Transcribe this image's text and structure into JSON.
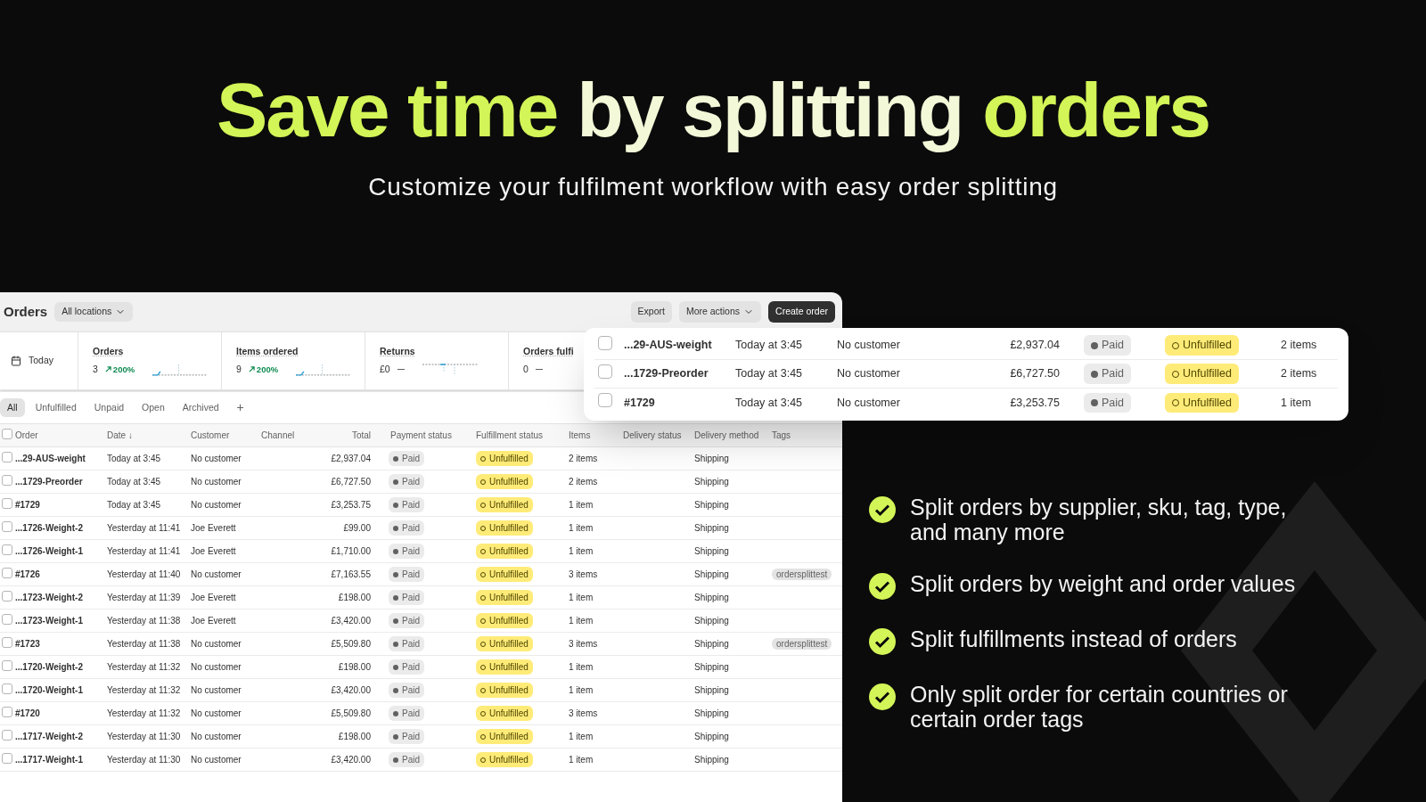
{
  "headline": [
    {
      "text": "Save time",
      "kind": "accent"
    },
    {
      "text": "by splitting",
      "kind": "plain"
    },
    {
      "text": "orders",
      "kind": "accent"
    }
  ],
  "subtitle": "Customize your fulfilment workflow with easy order splitting",
  "orders_page": {
    "title": "Orders",
    "location_filter": "All locations",
    "actions": [
      {
        "label": "Export",
        "kind": "secondary"
      },
      {
        "label": "More actions",
        "kind": "menu"
      },
      {
        "label": "Create order",
        "kind": "primary"
      }
    ],
    "date_range": "Today",
    "stats": [
      {
        "label": "Orders",
        "value": "3",
        "change": "200%",
        "kind": "increase"
      },
      {
        "label": "Items ordered",
        "value": "9",
        "change": "200%",
        "kind": "increase"
      },
      {
        "label": "Returns",
        "value": "£0",
        "kind": "flat"
      },
      {
        "label": "Orders fulfi",
        "value": "0",
        "kind": "flat"
      }
    ],
    "tabs": [
      {
        "label": "All",
        "selected": true
      },
      {
        "label": "Unfulfilled",
        "selected": false
      },
      {
        "label": "Unpaid",
        "selected": false
      },
      {
        "label": "Open",
        "selected": false
      },
      {
        "label": "Archived",
        "selected": false
      }
    ],
    "add_tab": "+",
    "table": {
      "header_checked": false,
      "columns": [
        "Order",
        "Date ↓",
        "Customer",
        "Channel",
        "Total",
        "Payment status",
        "Fulfillment status",
        "Items",
        "Delivery status",
        "Delivery method",
        "Tags"
      ],
      "rows": [
        {
          "checked": false,
          "order": "...29-AUS-weight",
          "date": "Today at 3:45",
          "customer": "No customer",
          "total": "£2,937.04",
          "payment": "Paid",
          "fulfillment": "Unfulfilled",
          "items": "2 items",
          "delivery_method": "Shipping"
        },
        {
          "checked": false,
          "order": "...1729-Preorder",
          "date": "Today at 3:45",
          "customer": "No customer",
          "total": "£6,727.50",
          "payment": "Paid",
          "fulfillment": "Unfulfilled",
          "items": "2 items",
          "delivery_method": "Shipping"
        },
        {
          "checked": false,
          "order": "#1729",
          "date": "Today at 3:45",
          "customer": "No customer",
          "total": "£3,253.75",
          "payment": "Paid",
          "fulfillment": "Unfulfilled",
          "items": "1 item",
          "delivery_method": "Shipping"
        },
        {
          "checked": false,
          "order": "...1726-Weight-2",
          "date": "Yesterday at 11:41",
          "customer": "Joe Everett",
          "total": "£99.00",
          "payment": "Paid",
          "fulfillment": "Unfulfilled",
          "items": "1 item",
          "delivery_method": "Shipping"
        },
        {
          "checked": false,
          "order": "...1726-Weight-1",
          "date": "Yesterday at 11:41",
          "customer": "Joe Everett",
          "total": "£1,710.00",
          "payment": "Paid",
          "fulfillment": "Unfulfilled",
          "items": "1 item",
          "delivery_method": "Shipping"
        },
        {
          "checked": false,
          "order": "#1726",
          "date": "Yesterday at 11:40",
          "customer": "No customer",
          "total": "£7,163.55",
          "payment": "Paid",
          "fulfillment": "Unfulfilled",
          "items": "3 items",
          "delivery_method": "Shipping",
          "tag": "ordersplittest"
        },
        {
          "checked": false,
          "order": "...1723-Weight-2",
          "date": "Yesterday at 11:39",
          "customer": "Joe Everett",
          "total": "£198.00",
          "payment": "Paid",
          "fulfillment": "Unfulfilled",
          "items": "1 item",
          "delivery_method": "Shipping"
        },
        {
          "checked": false,
          "order": "...1723-Weight-1",
          "date": "Yesterday at 11:38",
          "customer": "Joe Everett",
          "total": "£3,420.00",
          "payment": "Paid",
          "fulfillment": "Unfulfilled",
          "items": "1 item",
          "delivery_method": "Shipping"
        },
        {
          "checked": false,
          "order": "#1723",
          "date": "Yesterday at 11:38",
          "customer": "No customer",
          "total": "£5,509.80",
          "payment": "Paid",
          "fulfillment": "Unfulfilled",
          "items": "3 items",
          "delivery_method": "Shipping",
          "tag": "ordersplittest"
        },
        {
          "checked": false,
          "order": "...1720-Weight-2",
          "date": "Yesterday at 11:32",
          "customer": "No customer",
          "total": "£198.00",
          "payment": "Paid",
          "fulfillment": "Unfulfilled",
          "items": "1 item",
          "delivery_method": "Shipping"
        },
        {
          "checked": false,
          "order": "...1720-Weight-1",
          "date": "Yesterday at 11:32",
          "customer": "No customer",
          "total": "£3,420.00",
          "payment": "Paid",
          "fulfillment": "Unfulfilled",
          "items": "1 item",
          "delivery_method": "Shipping"
        },
        {
          "checked": false,
          "order": "#1720",
          "date": "Yesterday at 11:32",
          "customer": "No customer",
          "total": "£5,509.80",
          "payment": "Paid",
          "fulfillment": "Unfulfilled",
          "items": "3 items",
          "delivery_method": "Shipping"
        },
        {
          "checked": false,
          "order": "...1717-Weight-2",
          "date": "Yesterday at 11:30",
          "customer": "No customer",
          "total": "£198.00",
          "payment": "Paid",
          "fulfillment": "Unfulfilled",
          "items": "1 item",
          "delivery_method": "Shipping"
        },
        {
          "checked": false,
          "order": "...1717-Weight-1",
          "date": "Yesterday at 11:30",
          "customer": "No customer",
          "total": "£3,420.00",
          "payment": "Paid",
          "fulfillment": "Unfulfilled",
          "items": "1 item",
          "delivery_method": "Shipping"
        }
      ]
    }
  },
  "highlight_card": {
    "rows": [
      {
        "checked": false,
        "order": "...29-AUS-weight",
        "date": "Today at 3:45",
        "customer": "No customer",
        "total": "£2,937.04",
        "payment": "Paid",
        "fulfillment": "Unfulfilled",
        "items": "2 items"
      },
      {
        "checked": false,
        "order": "...1729-Preorder",
        "date": "Today at 3:45",
        "customer": "No customer",
        "total": "£6,727.50",
        "payment": "Paid",
        "fulfillment": "Unfulfilled",
        "items": "2 items"
      },
      {
        "checked": false,
        "order": "#1729",
        "date": "Today at 3:45",
        "customer": "No customer",
        "total": "£3,253.75",
        "payment": "Paid",
        "fulfillment": "Unfulfilled",
        "items": "1 item"
      }
    ]
  },
  "features": [
    {
      "text": "Split orders by supplier, sku, tag, type, and many more"
    },
    {
      "text": "Split orders by weight and order values"
    },
    {
      "text": "Split fulfillments instead of orders"
    },
    {
      "text": "Only split order for certain countries or certain order tags"
    }
  ]
}
